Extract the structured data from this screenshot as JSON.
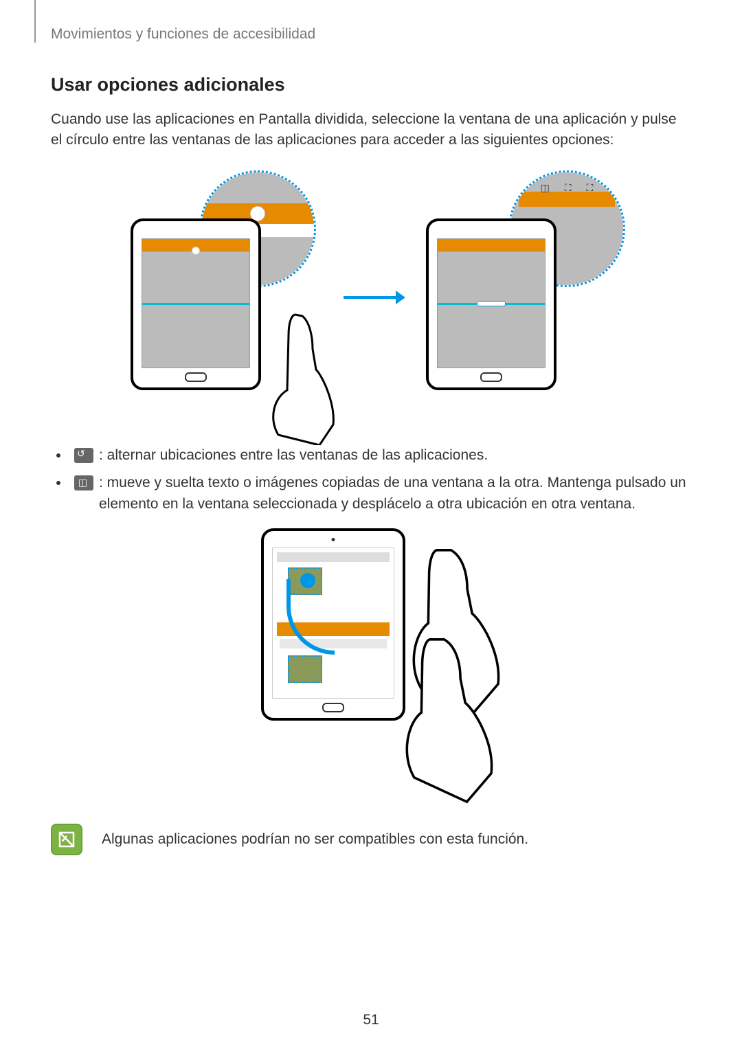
{
  "breadcrumb": "Movimientos y funciones de accesibilidad",
  "section_title": "Usar opciones adicionales",
  "intro_paragraph": "Cuando use las aplicaciones en Pantalla dividida, seleccione la ventana de una aplicación y pulse el círculo entre las ventanas de las aplicaciones para acceder a las siguientes opciones:",
  "bullet1_text": " : alternar ubicaciones entre las ventanas de las aplicaciones.",
  "bullet2_text": " : mueve y suelta texto o imágenes copiadas de una ventana a la otra. Mantenga pulsado un elemento en la ventana seleccionada y desplácelo a otra ubicación en otra ventana.",
  "note_text": "Algunas aplicaciones podrían no ser compatibles con esta función.",
  "page_number": "51"
}
